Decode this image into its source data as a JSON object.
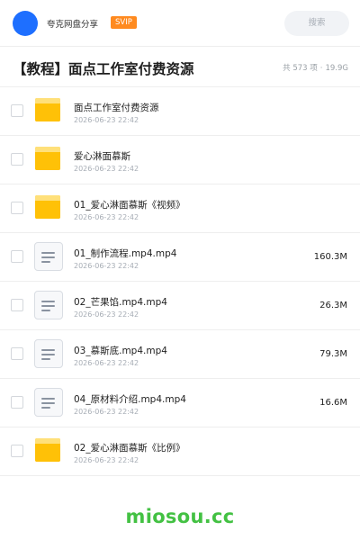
{
  "header": {
    "share_name": "夸克网盘分享",
    "badge": "SVIP",
    "search_label": "搜索"
  },
  "folder": {
    "title": "【教程】面点工作室付费资源",
    "count": "共 573 项",
    "separator": "·",
    "total_size": "19.9G"
  },
  "files": [
    {
      "name": "面点工作室付费资源",
      "date": "2026-06-23 22:42",
      "size": "",
      "type": "folder"
    },
    {
      "name": "爱心淋面慕斯",
      "date": "2026-06-23 22:42",
      "size": "",
      "type": "folder"
    },
    {
      "name": "01_爱心淋面慕斯《视频》",
      "date": "2026-06-23 22:42",
      "size": "",
      "type": "folder"
    },
    {
      "name": "01_制作流程.mp4.mp4",
      "date": "2026-06-23 22:42",
      "size": "160.3M",
      "type": "video"
    },
    {
      "name": "02_芒果馅.mp4.mp4",
      "date": "2026-06-23 22:42",
      "size": "26.3M",
      "type": "video"
    },
    {
      "name": "03_慕斯底.mp4.mp4",
      "date": "2026-06-23 22:42",
      "size": "79.3M",
      "type": "video"
    },
    {
      "name": "04_原材料介绍.mp4.mp4",
      "date": "2026-06-23 22:42",
      "size": "16.6M",
      "type": "video"
    },
    {
      "name": "02_爱心淋面慕斯《比例》",
      "date": "2026-06-23 22:42",
      "size": "",
      "type": "folder"
    }
  ],
  "watermark": "miosou.cc",
  "colors": {
    "avatar": "#1e6fff",
    "svip": "#ff8a1f",
    "folder": "#ffc107",
    "watermark": "#43c143"
  }
}
